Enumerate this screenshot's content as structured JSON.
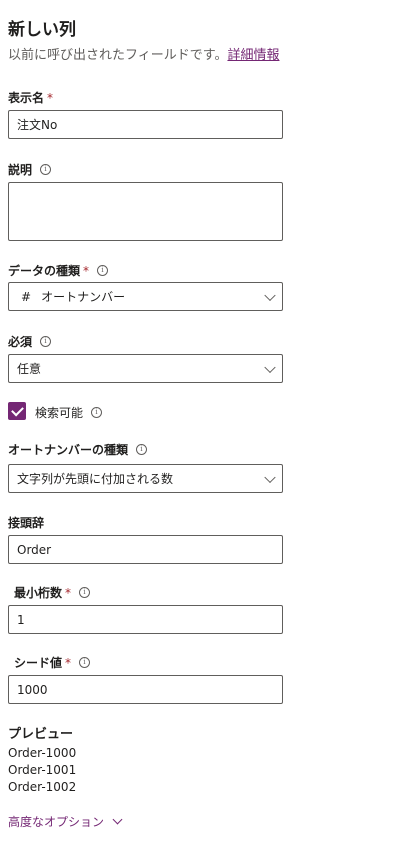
{
  "panel": {
    "title": "新しい列",
    "subtitle": "以前に呼び出されたフィールドです。",
    "details_link": "詳細情報"
  },
  "display_name": {
    "label": "表示名",
    "required_mark": "*",
    "value": "注文No"
  },
  "description": {
    "label": "説明",
    "value": ""
  },
  "data_type": {
    "label": "データの種類",
    "required_mark": "*",
    "icon_glyph": "#",
    "value": "オートナンバー"
  },
  "required": {
    "label": "必須",
    "value": "任意"
  },
  "searchable": {
    "label": "検索可能",
    "checked": true
  },
  "autonumber_type": {
    "label": "オートナンバーの種類",
    "value": "文字列が先頭に付加される数"
  },
  "prefix": {
    "label": "接頭辞",
    "value": "Order"
  },
  "min_digits": {
    "label": "最小桁数",
    "required_mark": "*",
    "value": "1"
  },
  "seed": {
    "label": "シード値",
    "required_mark": "*",
    "value": "1000"
  },
  "preview": {
    "label": "プレビュー",
    "lines": [
      "Order-1000",
      "Order-1001",
      "Order-1002"
    ]
  },
  "advanced": {
    "label": "高度なオプション"
  },
  "info_glyph": "i",
  "colors": {
    "accent": "#742774",
    "required": "#a4262c",
    "border": "#605e5c"
  }
}
